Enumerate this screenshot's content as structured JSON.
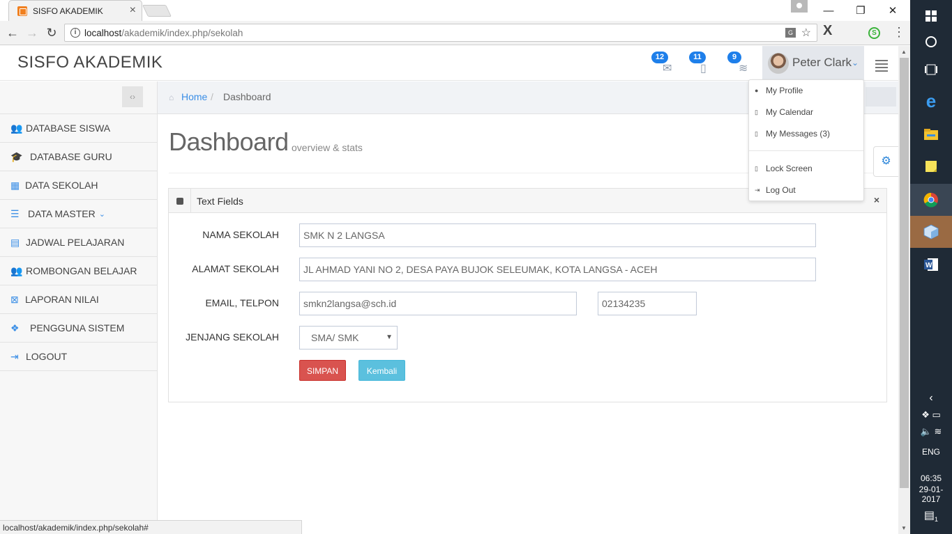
{
  "browser": {
    "tab_title": "SISFO AKADEMIK",
    "tab_close": "×",
    "url_host": "localhost",
    "url_path": "/akademik/index.php/sekolah",
    "status_url": "localhost/akademik/index.php/sekolah#",
    "ext_x": "X",
    "ext_s": "S",
    "win_min": "—",
    "win_max": "❐",
    "win_close": "✕"
  },
  "header": {
    "brand": "SISFO AKADEMIK",
    "notifications": [
      {
        "count": "12",
        "icon": "envelope-icon"
      },
      {
        "count": "11",
        "icon": "map-icon"
      },
      {
        "count": "9",
        "icon": "wifi-icon"
      }
    ],
    "user_name": "Peter Clark"
  },
  "user_menu": {
    "items": [
      {
        "label": "My Profile",
        "icon": "user-icon"
      },
      {
        "label": "My Calendar",
        "icon": "calendar-icon"
      },
      {
        "label": "My Messages (3)",
        "icon": "envelope-icon"
      },
      {
        "label": "Lock Screen",
        "icon": "lock-icon"
      },
      {
        "label": "Log Out",
        "icon": "logout-icon"
      }
    ]
  },
  "sidebar": {
    "toggler": "‹›",
    "items": [
      {
        "label": "DATABASE SISWA",
        "icon": "users-icon"
      },
      {
        "label": "DATABASE GURU",
        "icon": "graduation-cap-icon"
      },
      {
        "label": "DATA SEKOLAH",
        "icon": "building-icon"
      },
      {
        "label": "DATA MASTER",
        "icon": "list-icon"
      },
      {
        "label": "JADWAL PELAJARAN",
        "icon": "calendar-icon"
      },
      {
        "label": "ROMBONGAN BELAJAR",
        "icon": "users-icon"
      },
      {
        "label": "LAPORAN NILAI",
        "icon": "excel-file-icon"
      },
      {
        "label": "PENGGUNA SISTEM",
        "icon": "cubes-icon"
      },
      {
        "label": "LOGOUT",
        "icon": "sign-out-icon"
      }
    ]
  },
  "breadcrumb": {
    "home": "Home",
    "separator": "/",
    "current": "Dashboard"
  },
  "page": {
    "title": "Dashboard",
    "subtitle": "overview & stats"
  },
  "portlet": {
    "title": "Text Fields",
    "close": "×"
  },
  "form": {
    "nama_label": "NAMA SEKOLAH",
    "nama_value": "SMK N 2 LANGSA",
    "alamat_label": "ALAMAT SEKOLAH",
    "alamat_value": "JL AHMAD YANI NO 2, DESA PAYA BUJOK SELEUMAK, KOTA LANGSA - ACEH",
    "email_label": "EMAIL, TELPON",
    "email_value": "smkn2langsa@sch.id",
    "telpon_value": "02134235",
    "jenjang_label": "JENJANG SEKOLAH",
    "jenjang_value": "SMA/ SMK",
    "save_label": "SIMPAN",
    "back_label": "Kembali"
  },
  "taskbar": {
    "lang": "ENG",
    "time": "06:35",
    "date": "29-01-2017",
    "notif_count": "1"
  },
  "colors": {
    "accent": "#3a8ee6",
    "badge": "#1e7fea",
    "danger": "#d9534f",
    "info": "#5bc0de"
  }
}
